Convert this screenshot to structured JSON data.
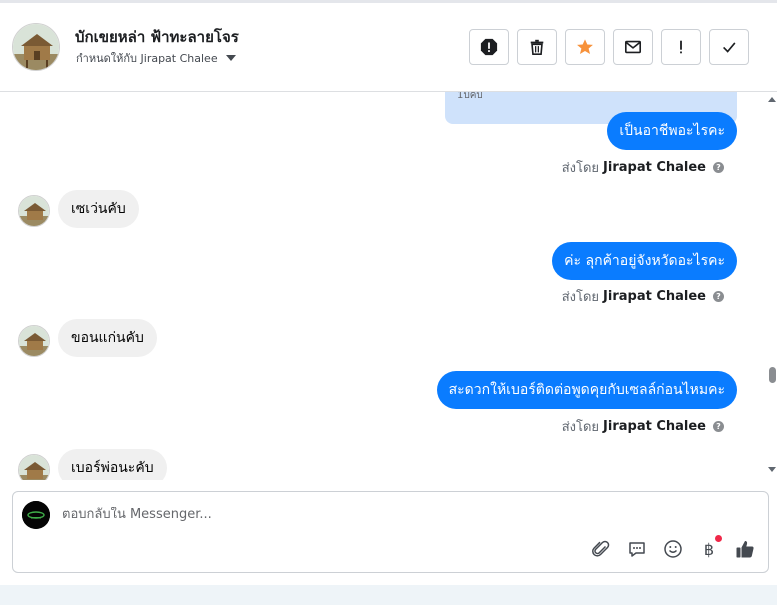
{
  "header": {
    "contact_name": "บักเขยหล่า ฟ้าทะลายโจร",
    "assigned_to": "กำหนดให้กับ Jirapat Chalee",
    "actions": [
      {
        "name": "mark-spam-button",
        "icon": "alert-octagon-icon"
      },
      {
        "name": "delete-button",
        "icon": "trash-icon"
      },
      {
        "name": "star-button",
        "icon": "star-icon"
      },
      {
        "name": "mark-unread-button",
        "icon": "envelope-icon"
      },
      {
        "name": "follow-up-button",
        "icon": "exclamation-icon"
      },
      {
        "name": "mark-done-button",
        "icon": "check-icon"
      }
    ],
    "star_color": "#f7923b"
  },
  "conversation": {
    "note_fragment": "1ปีคับ",
    "sent_prefix": "ส่งโดย",
    "agent_name": "Jirapat Chalee",
    "messages": [
      {
        "dir": "out",
        "text": "เป็นอาชีพอะไรคะ"
      },
      {
        "dir": "in",
        "text": "เซเว่นคับ"
      },
      {
        "dir": "out",
        "text": "ค่ะ  ลุกค้าอยู่จังหวัดอะไรคะ"
      },
      {
        "dir": "in",
        "text": "ขอนแก่นคับ"
      },
      {
        "dir": "out",
        "text": "สะดวกให้เบอร์ติดต่อพูดคุยกับเซลล์ก่อนไหมคะ"
      },
      {
        "dir": "in",
        "text": "เบอร์พ่อนะคับ"
      }
    ],
    "outgoing_color": "#0a7cff"
  },
  "composer": {
    "placeholder": "ตอบกลับใน Messenger...",
    "tools": [
      "paperclip-icon",
      "saved-reply-icon",
      "emoji-icon",
      "baht-icon",
      "thumbs-up-icon"
    ],
    "baht_symbol": "฿"
  }
}
